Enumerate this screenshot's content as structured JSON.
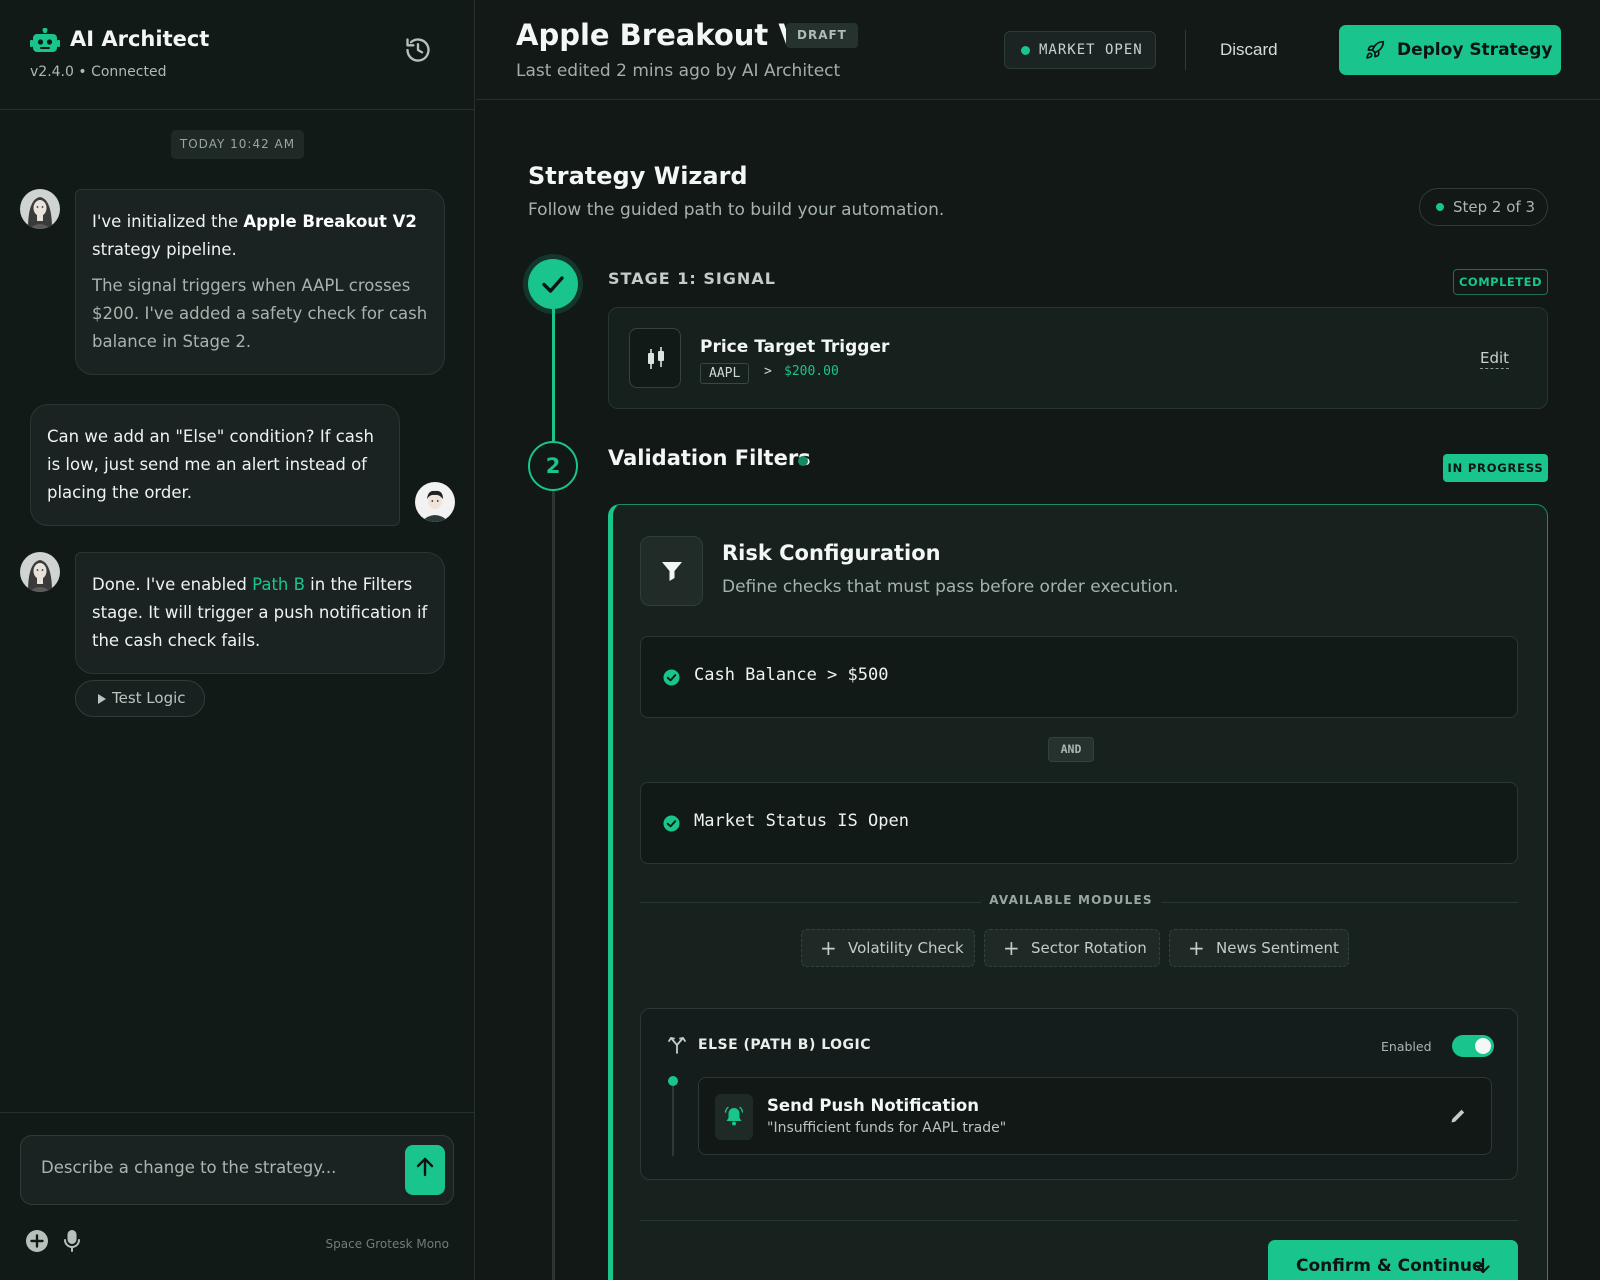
{
  "colors": {
    "accent": "#19c48d",
    "background": "#111816",
    "panel": "#121a18",
    "card": "#17211e"
  },
  "sidebar": {
    "brand": {
      "title": "AI Architect",
      "subtitle": "v2.4.0 • Connected",
      "icon": "robot-icon"
    },
    "history_icon": "history-icon",
    "chat_date": "TODAY 10:42 AM",
    "messages": [
      {
        "role": "ai",
        "lead": "I've initialized the ",
        "bold": "Apple Breakout V2",
        "tail": " strategy pipeline.",
        "detail": "The signal triggers when AAPL crosses $200. I've added a safety check for cash balance in Stage 2."
      },
      {
        "role": "user",
        "text": "Can we add an \"Else\" condition? If cash is low, just send me an alert instead of placing the order."
      },
      {
        "role": "ai",
        "lead": "Done. I've enabled ",
        "highlight": "Path B",
        "tail": " in the Filters stage. It will trigger a push notification if the cash check fails."
      }
    ],
    "test_logic_label": "Test Logic",
    "input_placeholder": "Describe a change to the strategy...",
    "font_note": "Space Grotesk Mono"
  },
  "topbar": {
    "title": "Apple Breakout V2",
    "draft_badge": "DRAFT",
    "subtitle": "Last edited 2 mins ago by AI Architect",
    "market_status": "MARKET OPEN",
    "discard_label": "Discard",
    "deploy_label": "Deploy Strategy"
  },
  "wizard": {
    "title": "Strategy Wizard",
    "subtitle": "Follow the guided path to build your automation.",
    "step_indicator": "Step 2 of 3",
    "stage1": {
      "label": "STAGE 1: SIGNAL",
      "status": "COMPLETED",
      "card_title": "Price Target Trigger",
      "ticker": "AAPL",
      "operator": ">",
      "target": "$200.00",
      "edit_label": "Edit"
    },
    "stage2": {
      "number": "2",
      "title": "Validation Filters",
      "status": "IN PROGRESS",
      "risk_title": "Risk Configuration",
      "risk_subtitle": "Define checks that must pass before order execution.",
      "conditions": [
        "Cash Balance > $500",
        "Market Status IS Open"
      ],
      "joiner": "AND",
      "modules_label": "AVAILABLE MODULES",
      "modules": [
        "Volatility Check",
        "Sector Rotation",
        "News Sentiment"
      ],
      "else_title": "ELSE (PATH B) LOGIC",
      "else_enabled_label": "Enabled",
      "else_enabled": true,
      "action_title": "Send Push Notification",
      "action_message": "\"Insufficient funds for AAPL trade\"",
      "confirm_label": "Confirm & Continue"
    }
  }
}
